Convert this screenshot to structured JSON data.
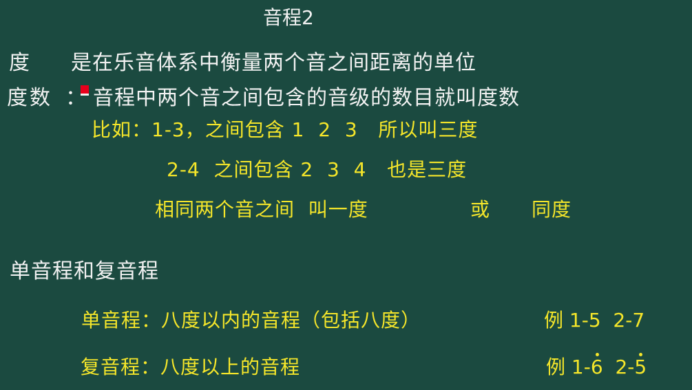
{
  "title": "音程2",
  "definitions": {
    "du_term": "度",
    "du_text": "是在乐音体系中衡量两个音之间距离的单位",
    "dushu_term": "度数",
    "dushu_colon": "：",
    "dushu_text": "音程中两个音之间包含的音级的数目就叫度数"
  },
  "examples": {
    "line1": "比如：1-3，之间包含 1  2  3   所以叫三度",
    "line2": "2-4  之间包含 2  3  4   也是三度",
    "line3_a": "相同两个音之间  叫一度",
    "line3_b": "或",
    "line3_c": "同度"
  },
  "section": {
    "heading": "单音程和复音程",
    "simple_label": "单音程：八度以内的音程（包括八度）",
    "simple_example": "例 1-5  2-7",
    "compound_label": "复音程：八度以上的音程",
    "compound_ex_prefix": "例 1-",
    "compound_ex_6": "6",
    "compound_ex_mid": "  2-",
    "compound_ex_5": "5"
  },
  "colors": {
    "background": "#1b4a40",
    "white_text": "#f2f2f2",
    "yellow_text": "#f5e62a",
    "cursor_marker": "#e8001c"
  }
}
